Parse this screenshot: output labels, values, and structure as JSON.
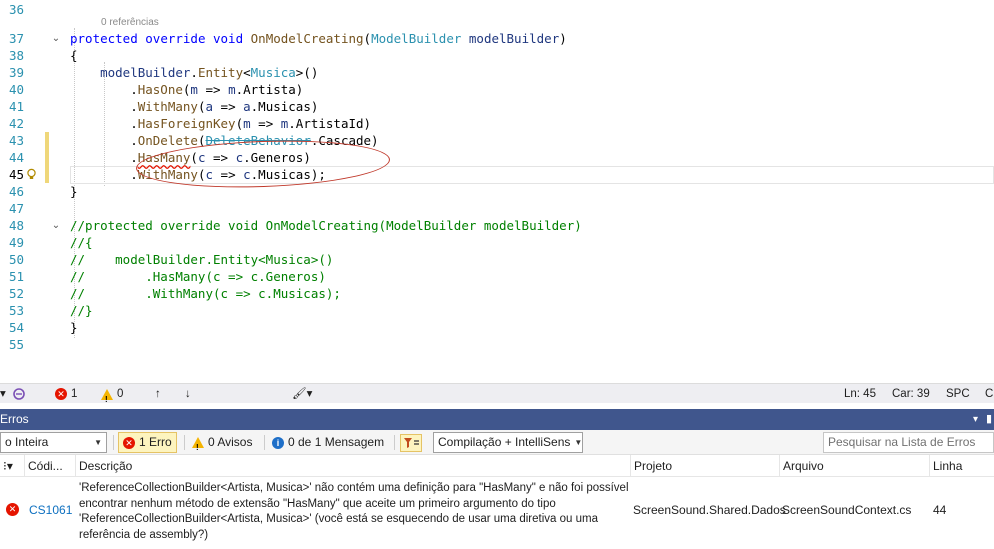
{
  "editor": {
    "codelens": "0 referências",
    "lines": [
      {
        "num": "36",
        "tokens": []
      },
      {
        "num": "37",
        "tokens": [
          {
            "t": "protected ",
            "c": "kw"
          },
          {
            "t": "override ",
            "c": "kw"
          },
          {
            "t": "void ",
            "c": "kw"
          },
          {
            "t": "OnModelCreating",
            "c": "method"
          },
          {
            "t": "(",
            "c": "plain"
          },
          {
            "t": "ModelBuilder ",
            "c": "type"
          },
          {
            "t": "modelBuilder",
            "c": "param"
          },
          {
            "t": ")",
            "c": "plain"
          }
        ]
      },
      {
        "num": "38",
        "tokens": [
          {
            "t": "{",
            "c": "plain"
          }
        ]
      },
      {
        "num": "39",
        "tokens": [
          {
            "t": "    modelBuilder",
            "c": "param"
          },
          {
            "t": ".",
            "c": "plain"
          },
          {
            "t": "Entity",
            "c": "method"
          },
          {
            "t": "<",
            "c": "plain"
          },
          {
            "t": "Musica",
            "c": "type"
          },
          {
            "t": ">()",
            "c": "plain"
          }
        ]
      },
      {
        "num": "40",
        "tokens": [
          {
            "t": "        .",
            "c": "plain"
          },
          {
            "t": "HasOne",
            "c": "method"
          },
          {
            "t": "(",
            "c": "plain"
          },
          {
            "t": "m",
            "c": "param"
          },
          {
            "t": " => ",
            "c": "plain"
          },
          {
            "t": "m",
            "c": "param"
          },
          {
            "t": ".Artista)",
            "c": "plain"
          }
        ]
      },
      {
        "num": "41",
        "tokens": [
          {
            "t": "        .",
            "c": "plain"
          },
          {
            "t": "WithMany",
            "c": "method"
          },
          {
            "t": "(",
            "c": "plain"
          },
          {
            "t": "a",
            "c": "param"
          },
          {
            "t": " => ",
            "c": "plain"
          },
          {
            "t": "a",
            "c": "param"
          },
          {
            "t": ".Musicas)",
            "c": "plain"
          }
        ]
      },
      {
        "num": "42",
        "tokens": [
          {
            "t": "        .",
            "c": "plain"
          },
          {
            "t": "HasForeignKey",
            "c": "method"
          },
          {
            "t": "(",
            "c": "plain"
          },
          {
            "t": "m",
            "c": "param"
          },
          {
            "t": " => ",
            "c": "plain"
          },
          {
            "t": "m",
            "c": "param"
          },
          {
            "t": ".ArtistaId)",
            "c": "plain"
          }
        ]
      },
      {
        "num": "43",
        "tokens": [
          {
            "t": "        .",
            "c": "plain"
          },
          {
            "t": "OnDelete",
            "c": "method"
          },
          {
            "t": "(",
            "c": "plain"
          },
          {
            "t": "DeleteBehavior",
            "c": "type strike"
          },
          {
            "t": ".Cascade)",
            "c": "plain"
          }
        ]
      },
      {
        "num": "44",
        "tokens": [
          {
            "t": "        .",
            "c": "plain"
          },
          {
            "t": "HasMany",
            "c": "method squiggle"
          },
          {
            "t": "(",
            "c": "plain"
          },
          {
            "t": "c",
            "c": "param"
          },
          {
            "t": " => ",
            "c": "plain"
          },
          {
            "t": "c",
            "c": "param"
          },
          {
            "t": ".Generos)",
            "c": "plain"
          }
        ]
      },
      {
        "num": "45",
        "tokens": [
          {
            "t": "        .",
            "c": "plain"
          },
          {
            "t": "WithMany",
            "c": "method"
          },
          {
            "t": "(",
            "c": "plain"
          },
          {
            "t": "c",
            "c": "param"
          },
          {
            "t": " => ",
            "c": "plain"
          },
          {
            "t": "c",
            "c": "param"
          },
          {
            "t": ".Musicas);",
            "c": "plain"
          }
        ]
      },
      {
        "num": "46",
        "tokens": [
          {
            "t": "}",
            "c": "plain"
          }
        ]
      },
      {
        "num": "47",
        "tokens": []
      },
      {
        "num": "48",
        "tokens": [
          {
            "t": "//protected override void OnModelCreating(ModelBuilder modelBuilder)",
            "c": "comment"
          }
        ]
      },
      {
        "num": "49",
        "tokens": [
          {
            "t": "//{",
            "c": "comment"
          }
        ]
      },
      {
        "num": "50",
        "tokens": [
          {
            "t": "//    modelBuilder.Entity<Musica>()",
            "c": "comment"
          }
        ]
      },
      {
        "num": "51",
        "tokens": [
          {
            "t": "//        .HasMany(c => c.Generos)",
            "c": "comment"
          }
        ]
      },
      {
        "num": "52",
        "tokens": [
          {
            "t": "//        .WithMany(c => c.Musicas);",
            "c": "comment"
          }
        ]
      },
      {
        "num": "53",
        "tokens": [
          {
            "t": "//}",
            "c": "comment"
          }
        ]
      },
      {
        "num": "54",
        "tokens": [
          {
            "t": "}",
            "c": "plain"
          }
        ]
      },
      {
        "num": "55",
        "tokens": []
      }
    ],
    "current_line": "45",
    "colors": {
      "keyword": "#0000ff",
      "type": "#2b91af",
      "method": "#74531f",
      "param": "#1f377f",
      "comment": "#008000",
      "squiggle": "#e51400"
    }
  },
  "statusstrip": {
    "error_count": "1",
    "warning_count": "0",
    "position_line": "Ln: 45",
    "position_col": "Car: 39",
    "mode": "SPC",
    "line_ending": "CR"
  },
  "error_panel": {
    "title": "Erros",
    "scope_dropdown": "o Inteira",
    "errors_filter": "1 Erro",
    "warnings_filter": "0 Avisos",
    "messages_filter": "0 de 1 Mensagem",
    "build_dropdown": "Compilação + IntelliSens",
    "search_placeholder": "Pesquisar na Lista de Erros",
    "columns": {
      "code": "Códi...",
      "description": "Descrição",
      "project": "Projeto",
      "file": "Arquivo",
      "line": "Linha"
    },
    "row": {
      "code": "CS1061",
      "description": "'ReferenceCollectionBuilder<Artista, Musica>' não contém uma definição para \"HasMany\" e não foi possível encontrar nenhum método de extensão \"HasMany\" que aceite um primeiro argumento do tipo 'ReferenceCollectionBuilder<Artista, Musica>' (você está se esquecendo de usar uma diretiva ou uma referência de assembly?)",
      "project": "ScreenSound.Shared.Dados",
      "file": "ScreenSoundContext.cs",
      "line": "44"
    },
    "accent": "#40568d"
  }
}
